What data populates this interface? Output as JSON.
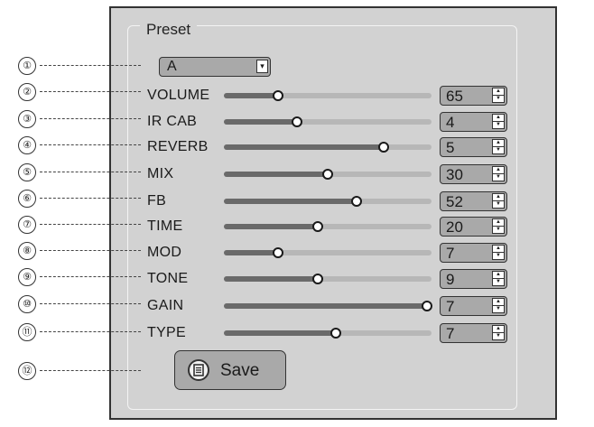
{
  "window": {
    "title": "Preset"
  },
  "preset": {
    "selected": "A",
    "dropdown_arrow": "▾"
  },
  "callouts": [
    "①",
    "②",
    "③",
    "④",
    "⑤",
    "⑥",
    "⑦",
    "⑧",
    "⑨",
    "⑩",
    "⑪",
    "⑫"
  ],
  "params": [
    {
      "key": "volume",
      "label": "VOLUME",
      "value": "65",
      "level": 0.26
    },
    {
      "key": "ir-cab",
      "label": "IR CAB",
      "value": "4",
      "level": 0.35
    },
    {
      "key": "reverb",
      "label": "REVERB",
      "value": "5",
      "level": 0.77
    },
    {
      "key": "mix",
      "label": "MIX",
      "value": "30",
      "level": 0.5
    },
    {
      "key": "fb",
      "label": "FB",
      "value": "52",
      "level": 0.64
    },
    {
      "key": "time",
      "label": "TIME",
      "value": "20",
      "level": 0.45
    },
    {
      "key": "mod",
      "label": "MOD",
      "value": "7",
      "level": 0.26
    },
    {
      "key": "tone",
      "label": "TONE",
      "value": "9",
      "level": 0.45
    },
    {
      "key": "gain",
      "label": "GAIN",
      "value": "7",
      "level": 0.98
    },
    {
      "key": "type",
      "label": "TYPE",
      "value": "7",
      "level": 0.54
    }
  ],
  "save": {
    "label": "Save"
  },
  "icons": {
    "spin_up": "▲",
    "spin_down": "▼",
    "save": "document-icon"
  },
  "colors": {
    "panel": "#d2d2d2",
    "control": "#a9a9a9",
    "track": "#b7b7b7",
    "fill": "#6a6a6a"
  }
}
